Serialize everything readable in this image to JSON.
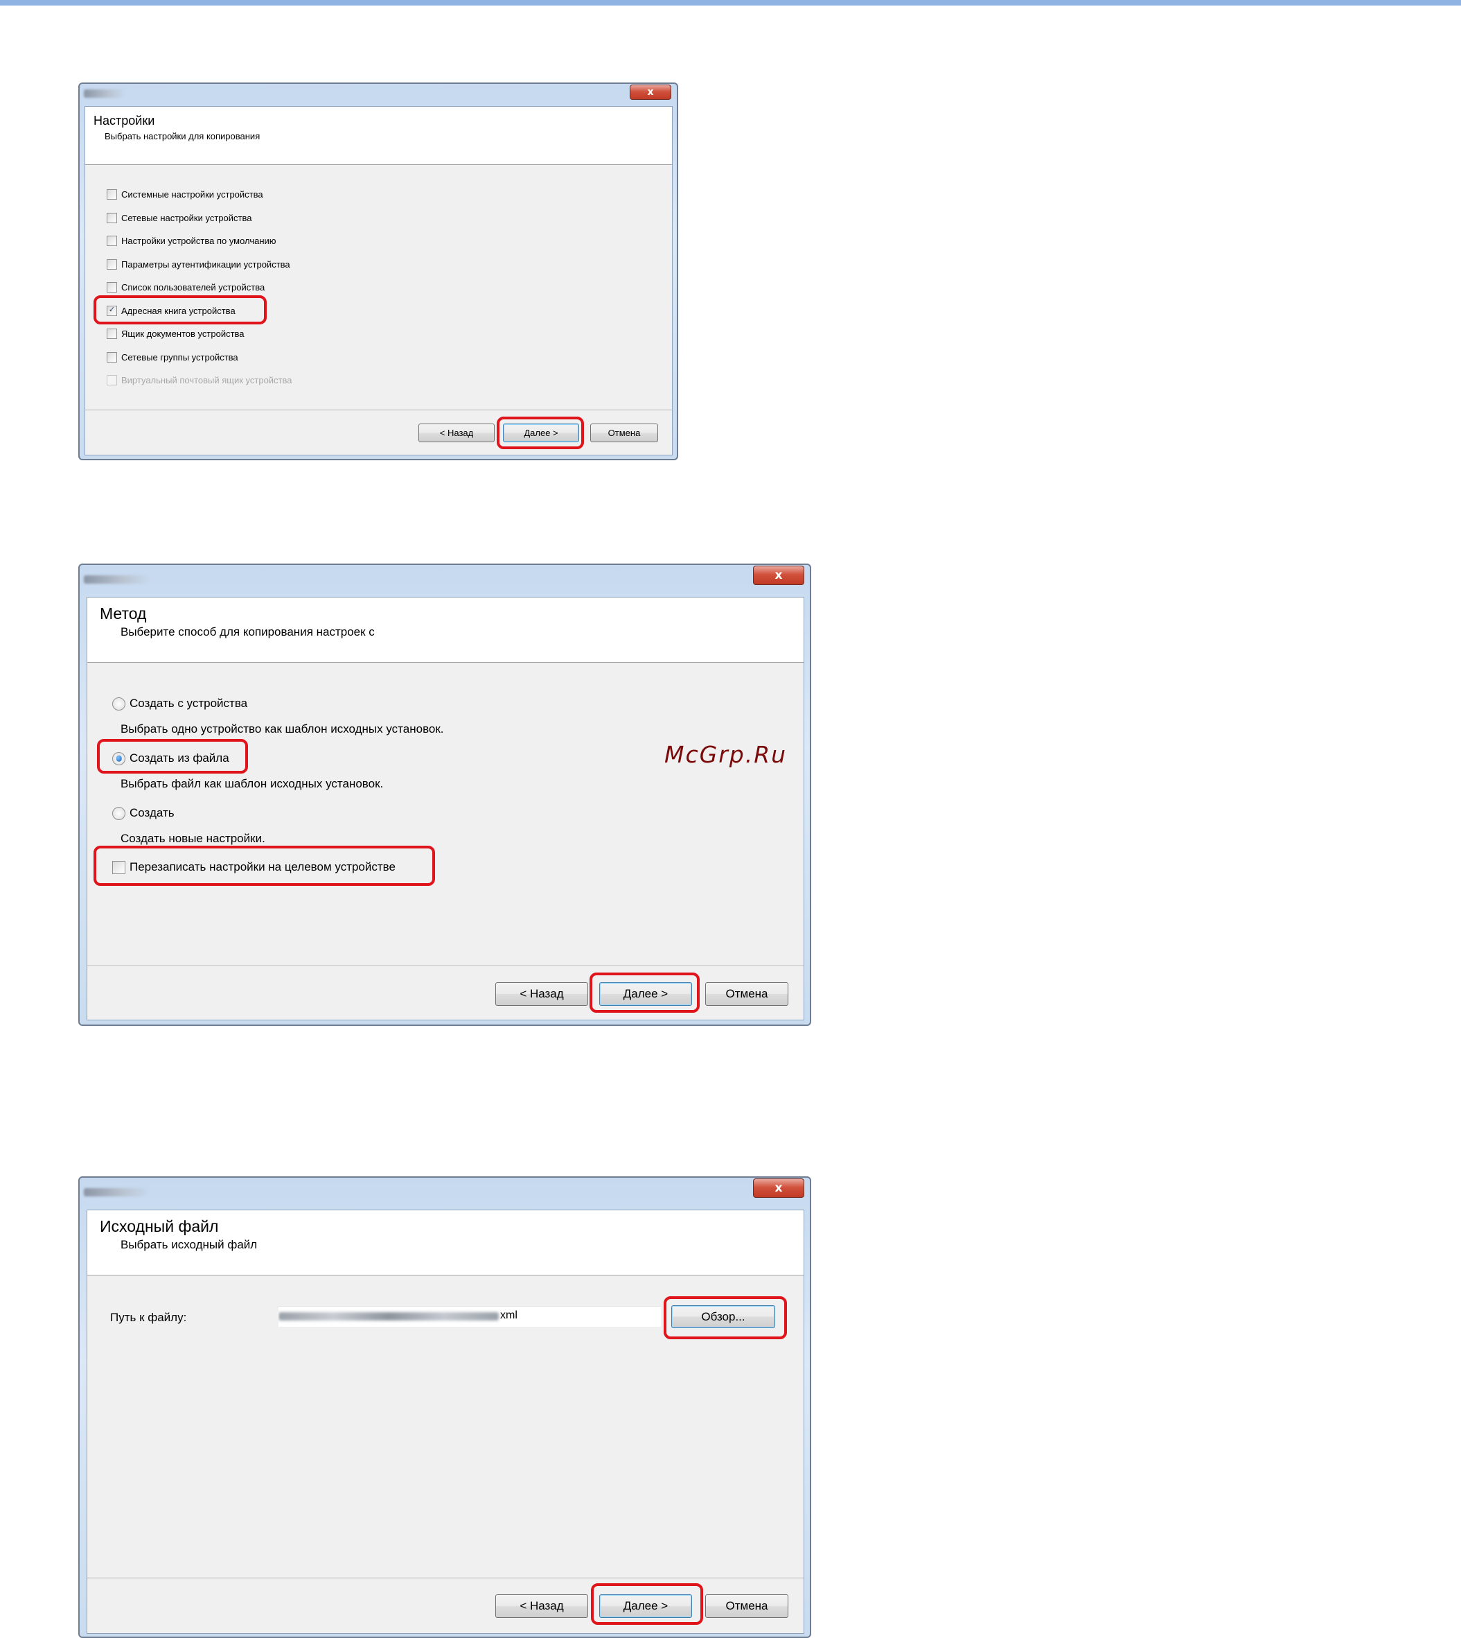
{
  "dialog1": {
    "title": "Настройки",
    "subtitle": "Выбрать настройки для копирования",
    "close_label": "x",
    "options": [
      {
        "label": "Системные настройки устройства",
        "checked": false,
        "enabled": true
      },
      {
        "label": "Сетевые настройки устройства",
        "checked": false,
        "enabled": true
      },
      {
        "label": "Настройки устройства по умолчанию",
        "checked": false,
        "enabled": true
      },
      {
        "label": "Параметры аутентификации устройства",
        "checked": false,
        "enabled": true
      },
      {
        "label": "Список пользователей устройства",
        "checked": false,
        "enabled": true
      },
      {
        "label": "Адресная книга устройства",
        "checked": true,
        "enabled": true
      },
      {
        "label": "Ящик документов устройства",
        "checked": false,
        "enabled": true
      },
      {
        "label": "Сетевые группы устройства",
        "checked": false,
        "enabled": true
      },
      {
        "label": "Виртуальный почтовый ящик устройства",
        "checked": false,
        "enabled": false
      }
    ],
    "buttons": {
      "back": "< Назад",
      "next": "Далее >",
      "cancel": "Отмена"
    }
  },
  "dialog2": {
    "title": "Метод",
    "subtitle": "Выберите способ для копирования настроек с",
    "close_label": "x",
    "radios": [
      {
        "label": "Создать с устройства",
        "description": "Выбрать одно устройство как шаблон исходных установок.",
        "selected": false
      },
      {
        "label": "Создать из файла",
        "description": "Выбрать файл как шаблон исходных установок.",
        "selected": true
      },
      {
        "label": "Создать",
        "description": "Создать новые настройки.",
        "selected": false
      }
    ],
    "overwrite_checkbox": {
      "label": "Перезаписать настройки на целевом устройстве",
      "checked": false
    },
    "buttons": {
      "back": "< Назад",
      "next": "Далее >",
      "cancel": "Отмена"
    }
  },
  "dialog3": {
    "title": "Исходный файл",
    "subtitle": "Выбрать исходный файл",
    "close_label": "x",
    "path_label": "Путь к файлу:",
    "path_value_suffix": "xml",
    "browse_label": "Обзор...",
    "buttons": {
      "back": "< Назад",
      "next": "Далее >",
      "cancel": "Отмена"
    }
  },
  "watermark": "McGrp.Ru",
  "colors": {
    "highlight": "#e0141b",
    "window_frame": "#c6d9ef",
    "client_bg": "#f0f0f0",
    "close_button": "#c13a24"
  }
}
